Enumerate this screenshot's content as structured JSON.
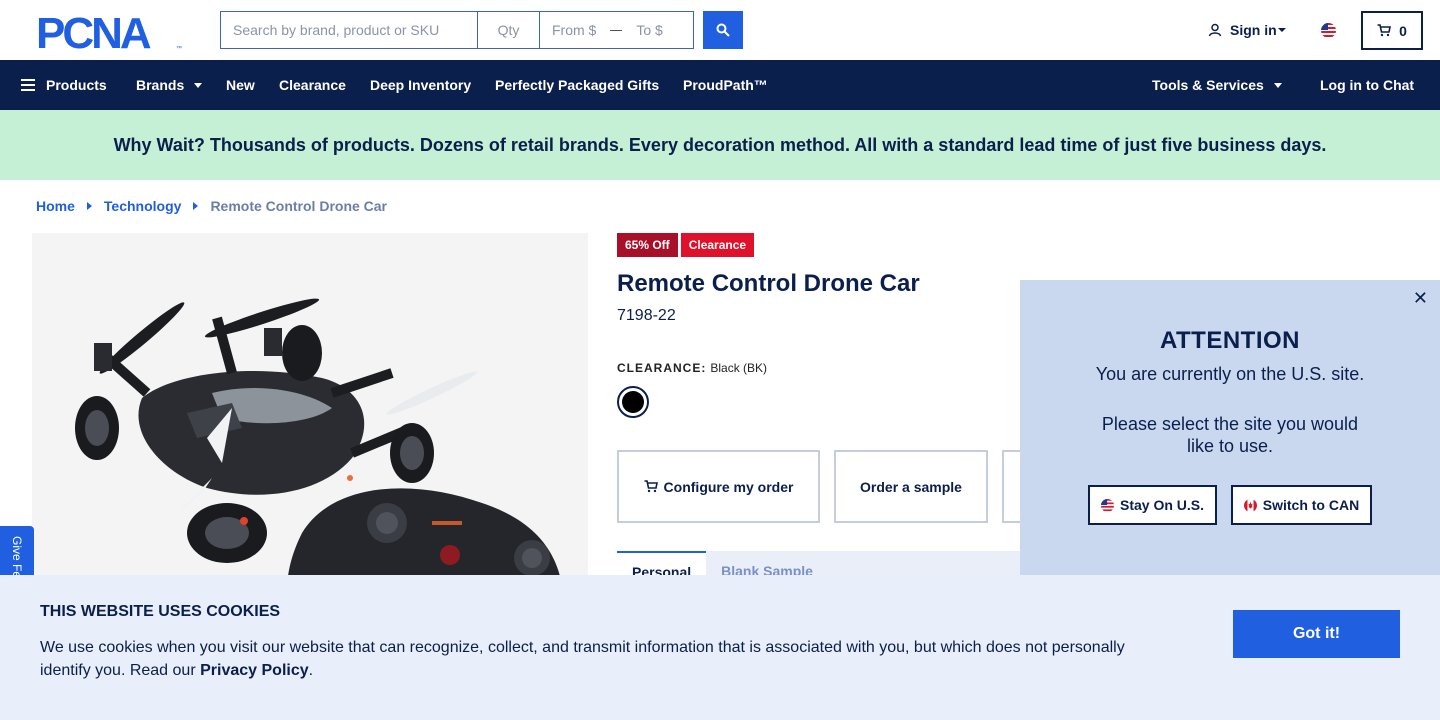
{
  "header": {
    "logo_text": "PCNA",
    "search": {
      "placeholder": "Search by brand, product or SKU",
      "qty_placeholder": "Qty",
      "from_placeholder": "From $",
      "to_placeholder": "To $"
    },
    "sign_in": "Sign in",
    "cart_count": "0"
  },
  "nav": {
    "products": "Products",
    "items": [
      "Brands",
      "New",
      "Clearance",
      "Deep Inventory",
      "Perfectly Packaged Gifts",
      "ProudPath™"
    ],
    "tools": "Tools & Services",
    "chat": "Log in to Chat"
  },
  "promo": "Why Wait? Thousands of products. Dozens of retail brands. Every decoration method. All with a standard lead time of just five business days.",
  "breadcrumb": {
    "home": "Home",
    "category": "Technology",
    "current": "Remote Control Drone Car"
  },
  "product": {
    "badge_off": "65% Off",
    "badge_clearance": "Clearance",
    "title": "Remote Control Drone Car",
    "sku": "7198-22",
    "color_label": "CLEARANCE:",
    "color_value": "Black (BK)",
    "configure": "Configure my order",
    "sample": "Order a sample",
    "tab_active": "Personal",
    "tab_inactive": "Blank  Sample"
  },
  "feedback": "Give Feedback",
  "attention": {
    "title": "ATTENTION",
    "msg1": "You are currently on the U.S. site.",
    "msg2": "Please select the site you would like to use.",
    "stay": "Stay On U.S.",
    "switch": "Switch to CAN"
  },
  "cookie": {
    "title": "THIS WEBSITE USES COOKIES",
    "text": "We use cookies when you visit our website that can recognize, collect, and transmit information that is associated with you, but which does not personally identify you. Read our",
    "link": "Privacy Policy",
    "button": "Got it!"
  },
  "colors": {
    "navy": "#0b1f4d",
    "blue": "#1f5fe0",
    "promo": "#c6f0d6",
    "red": "#e0112b"
  }
}
